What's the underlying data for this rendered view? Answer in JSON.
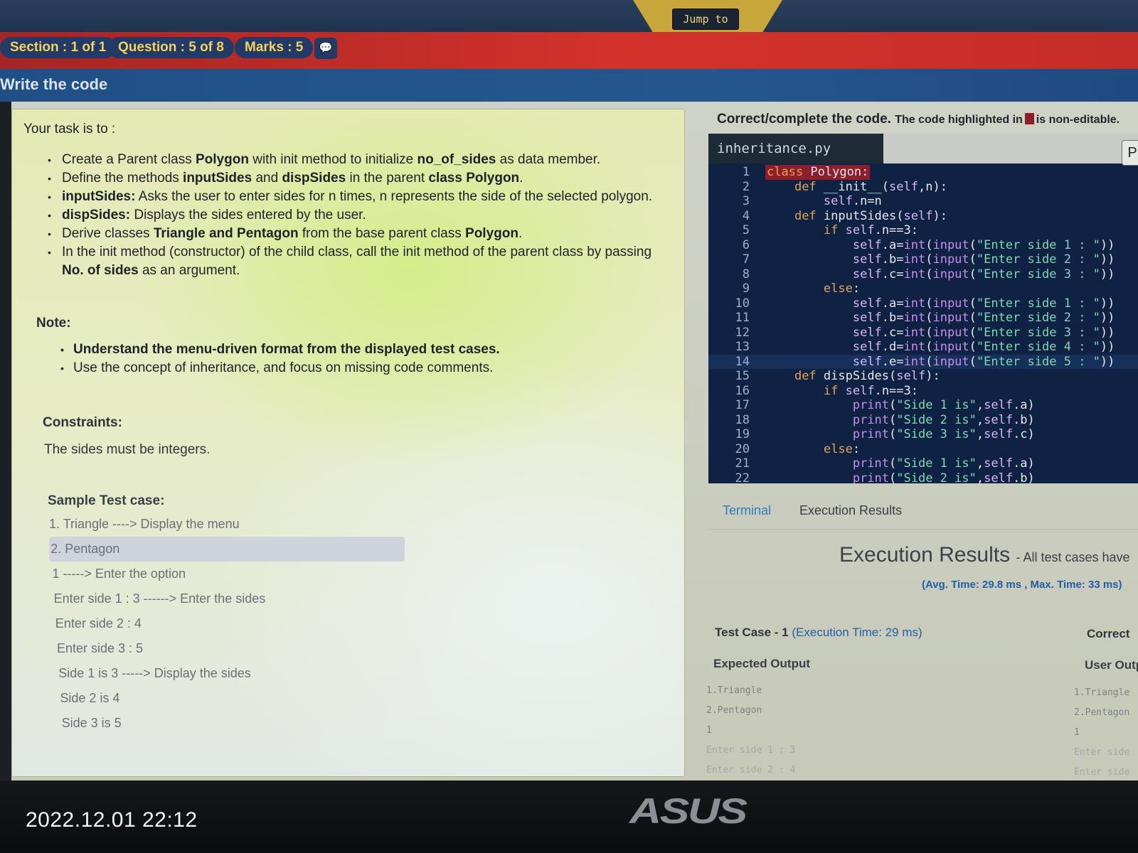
{
  "header": {
    "jump_label": "Jump to"
  },
  "info": {
    "section": "Section : 1 of 1",
    "question": "Question : 5 of 8",
    "marks": "Marks : 5",
    "chat_icon": "chat-bubble-icon"
  },
  "page_title": "Write the code",
  "task": {
    "intro": "Your task is to :",
    "items": [
      [
        "Create a Parent class ",
        "Polygon",
        " with init method to initialize ",
        "no_of_sides",
        " as data member."
      ],
      [
        "Define the methods ",
        "inputSides",
        " and ",
        "dispSides",
        " in the parent ",
        "class Polygon",
        "."
      ],
      [
        "",
        "inputSides:",
        " Asks the user to enter sides for n times, n represents the side of the selected polygon."
      ],
      [
        "",
        "dispSides:",
        " Displays the sides entered by the user."
      ],
      [
        "Derive classes ",
        "Triangle and Pentagon",
        " from the base parent class ",
        "Polygon",
        "."
      ],
      [
        "In the init method (constructor) of the child class, call the init method of the parent class by passing ",
        "No. of sides",
        " as an argument."
      ]
    ],
    "note_label": "Note:",
    "notes": [
      "Understand the menu-driven format from the displayed test cases.",
      "Use the concept of inheritance, and focus on missing code comments."
    ],
    "constraints_label": "Constraints:",
    "constraints_text": "The sides must be integers.",
    "sample_label": "Sample Test case:",
    "sample_lines": [
      "1. Triangle ----> Display the menu",
      "2. Pentagon",
      "1 -----> Enter the option",
      "Enter side 1 : 3 ------> Enter the sides",
      "Enter side 2 : 4",
      "Enter side 3 : 5",
      "Side 1 is 3 -----> Display the sides",
      "Side 2 is 4",
      "Side 3 is 5"
    ]
  },
  "editor": {
    "instruction_bold": "Correct/complete the code.",
    "instruction_small_a": "The code highlighted in",
    "instruction_small_b": "is non-editable.",
    "filename": "inheritance.py",
    "side_button": "P",
    "lines": [
      {
        "n": "1",
        "text": "class Polygon:"
      },
      {
        "n": "2",
        "text": "    def __init__(self,n):"
      },
      {
        "n": "3",
        "text": "        self.n=n"
      },
      {
        "n": "4",
        "text": "    def inputSides(self):"
      },
      {
        "n": "5",
        "text": "        if self.n==3:"
      },
      {
        "n": "6",
        "text": "            self.a=int(input(\"Enter side 1 : \"))"
      },
      {
        "n": "7",
        "text": "            self.b=int(input(\"Enter side 2 : \"))"
      },
      {
        "n": "8",
        "text": "            self.c=int(input(\"Enter side 3 : \"))"
      },
      {
        "n": "9",
        "text": "        else:"
      },
      {
        "n": "10",
        "text": "            self.a=int(input(\"Enter side 1 : \"))"
      },
      {
        "n": "11",
        "text": "            self.b=int(input(\"Enter side 2 : \"))"
      },
      {
        "n": "12",
        "text": "            self.c=int(input(\"Enter side 3 : \"))"
      },
      {
        "n": "13",
        "text": "            self.d=int(input(\"Enter side 4 : \"))"
      },
      {
        "n": "14",
        "text": "            self.e=int(input(\"Enter side 5 : \"))"
      },
      {
        "n": "15",
        "text": "    def dispSides(self):"
      },
      {
        "n": "16",
        "text": "        if self.n==3:"
      },
      {
        "n": "17",
        "text": "            print(\"Side 1 is\",self.a)"
      },
      {
        "n": "18",
        "text": "            print(\"Side 2 is\",self.b)"
      },
      {
        "n": "19",
        "text": "            print(\"Side 3 is\",self.c)"
      },
      {
        "n": "20",
        "text": "        else:"
      },
      {
        "n": "21",
        "text": "            print(\"Side 1 is\",self.a)"
      },
      {
        "n": "22",
        "text": "            print(\"Side 2 is\",self.b)"
      }
    ],
    "current_line": 14,
    "noneditable_color": "#8e1e2a"
  },
  "results": {
    "tab_terminal": "Terminal",
    "tab_results": "Execution Results",
    "title": "Execution Results",
    "subtitle": "- All test cases have",
    "time_summary": "(Avg. Time: 29.8 ms , Max. Time: 33 ms)",
    "testcase_label": "Test Case - 1",
    "testcase_time": "(Execution Time: 29 ms)",
    "correct_label": "Correct",
    "expected_label": "Expected Output",
    "user_output_label": "User Output",
    "expected_lines": [
      "1.Triangle",
      "2.Pentagon",
      "1",
      "Enter side 1 : 3",
      "Enter side 2 : 4"
    ],
    "user_lines": [
      "1.Triangle",
      "2.Pentagon",
      "1",
      "Enter side",
      "Enter side"
    ]
  },
  "photo": {
    "timestamp": "2022.12.01 22:12",
    "brand": "ASUS"
  }
}
